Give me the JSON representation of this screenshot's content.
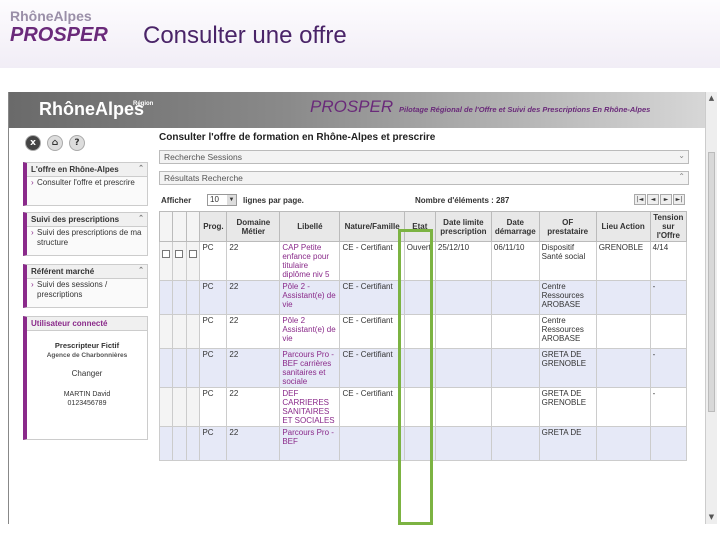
{
  "slide": {
    "logo_top": "RhôneAlpes",
    "logo_bottom": "PROSPER",
    "title": "Consulter une offre"
  },
  "banner": {
    "logo": "RhôneAlpes",
    "region": "Région",
    "title": "PROSPER",
    "subtitle": "Pilotage Régional de l'Offre et Suivi des Prescriptions En Rhône-Alpes"
  },
  "top_icons": [
    "x",
    "⌂",
    "?"
  ],
  "sidebar": {
    "panels": [
      {
        "title": "L'offre en Rhône-Alpes",
        "links": [
          "Consulter l'offre et prescrire"
        ]
      },
      {
        "title": "Suivi des prescriptions",
        "links": [
          "Suivi des prescriptions de ma structure"
        ]
      },
      {
        "title": "Référent marché",
        "links": [
          "Suivi des sessions / prescriptions"
        ]
      }
    ],
    "user": {
      "title": "Utilisateur connecté",
      "name": "Prescripteur Fictif",
      "agency": "Agence de Charbonnières",
      "change": "Changer",
      "person": "MARTIN David",
      "phone": "0123456789"
    }
  },
  "main": {
    "title": "Consulter l'offre de formation en Rhône-Alpes et prescrire",
    "acc1": "Recherche Sessions",
    "acc2": "Résultats Recherche",
    "afficher": "Afficher",
    "per_page_value": "10",
    "per_page_label": "lignes par page.",
    "count_label": "Nombre d'éléments : 287",
    "pager": [
      "|◄",
      "◄",
      "►",
      "►|"
    ],
    "columns": [
      "Prog.",
      "Domaine Métier",
      "Libellé",
      "Nature/Famille",
      "Etat",
      "Date limite prescription",
      "Date démarrage",
      "OF prestataire",
      "Lieu Action",
      "Tension sur l'Offre"
    ],
    "rows": [
      {
        "prog": "PC",
        "dom": "22",
        "lib": "CAP Petite enfance pour titulaire diplôme niv 5",
        "nat": "CE - Certifiant",
        "etat": "Ouvert",
        "dlim": "25/12/10",
        "ddem": "06/11/10",
        "of": "Dispositif Santé social",
        "lieu": "GRENOBLE",
        "tens": "4/14"
      },
      {
        "prog": "PC",
        "dom": "22",
        "lib": "Pôle 2 - Assistant(e) de vie",
        "nat": "CE - Certifiant",
        "etat": "",
        "dlim": "",
        "ddem": "",
        "of": "Centre Ressources AROBASE",
        "lieu": "",
        "tens": "-"
      },
      {
        "prog": "PC",
        "dom": "22",
        "lib": "Pôle 2 Assistant(e) de vie",
        "nat": "CE - Certifiant",
        "etat": "",
        "dlim": "",
        "ddem": "",
        "of": "Centre Ressources AROBASE",
        "lieu": "",
        "tens": ""
      },
      {
        "prog": "PC",
        "dom": "22",
        "lib": "Parcours Pro - BEF carrières sanitaires et sociale",
        "nat": "CE - Certifiant",
        "etat": "",
        "dlim": "",
        "ddem": "",
        "of": "GRETA DE GRENOBLE",
        "lieu": "",
        "tens": "-"
      },
      {
        "prog": "PC",
        "dom": "22",
        "lib": "DEF CARRIERES SANITAIRES ET SOCIALES",
        "nat": "CE - Certifiant",
        "etat": "",
        "dlim": "",
        "ddem": "",
        "of": "GRETA DE GRENOBLE",
        "lieu": "",
        "tens": "-"
      },
      {
        "prog": "PC",
        "dom": "22",
        "lib": "Parcours Pro - BEF",
        "nat": "",
        "etat": "",
        "dlim": "",
        "ddem": "",
        "of": "GRETA DE",
        "lieu": "",
        "tens": ""
      }
    ]
  }
}
